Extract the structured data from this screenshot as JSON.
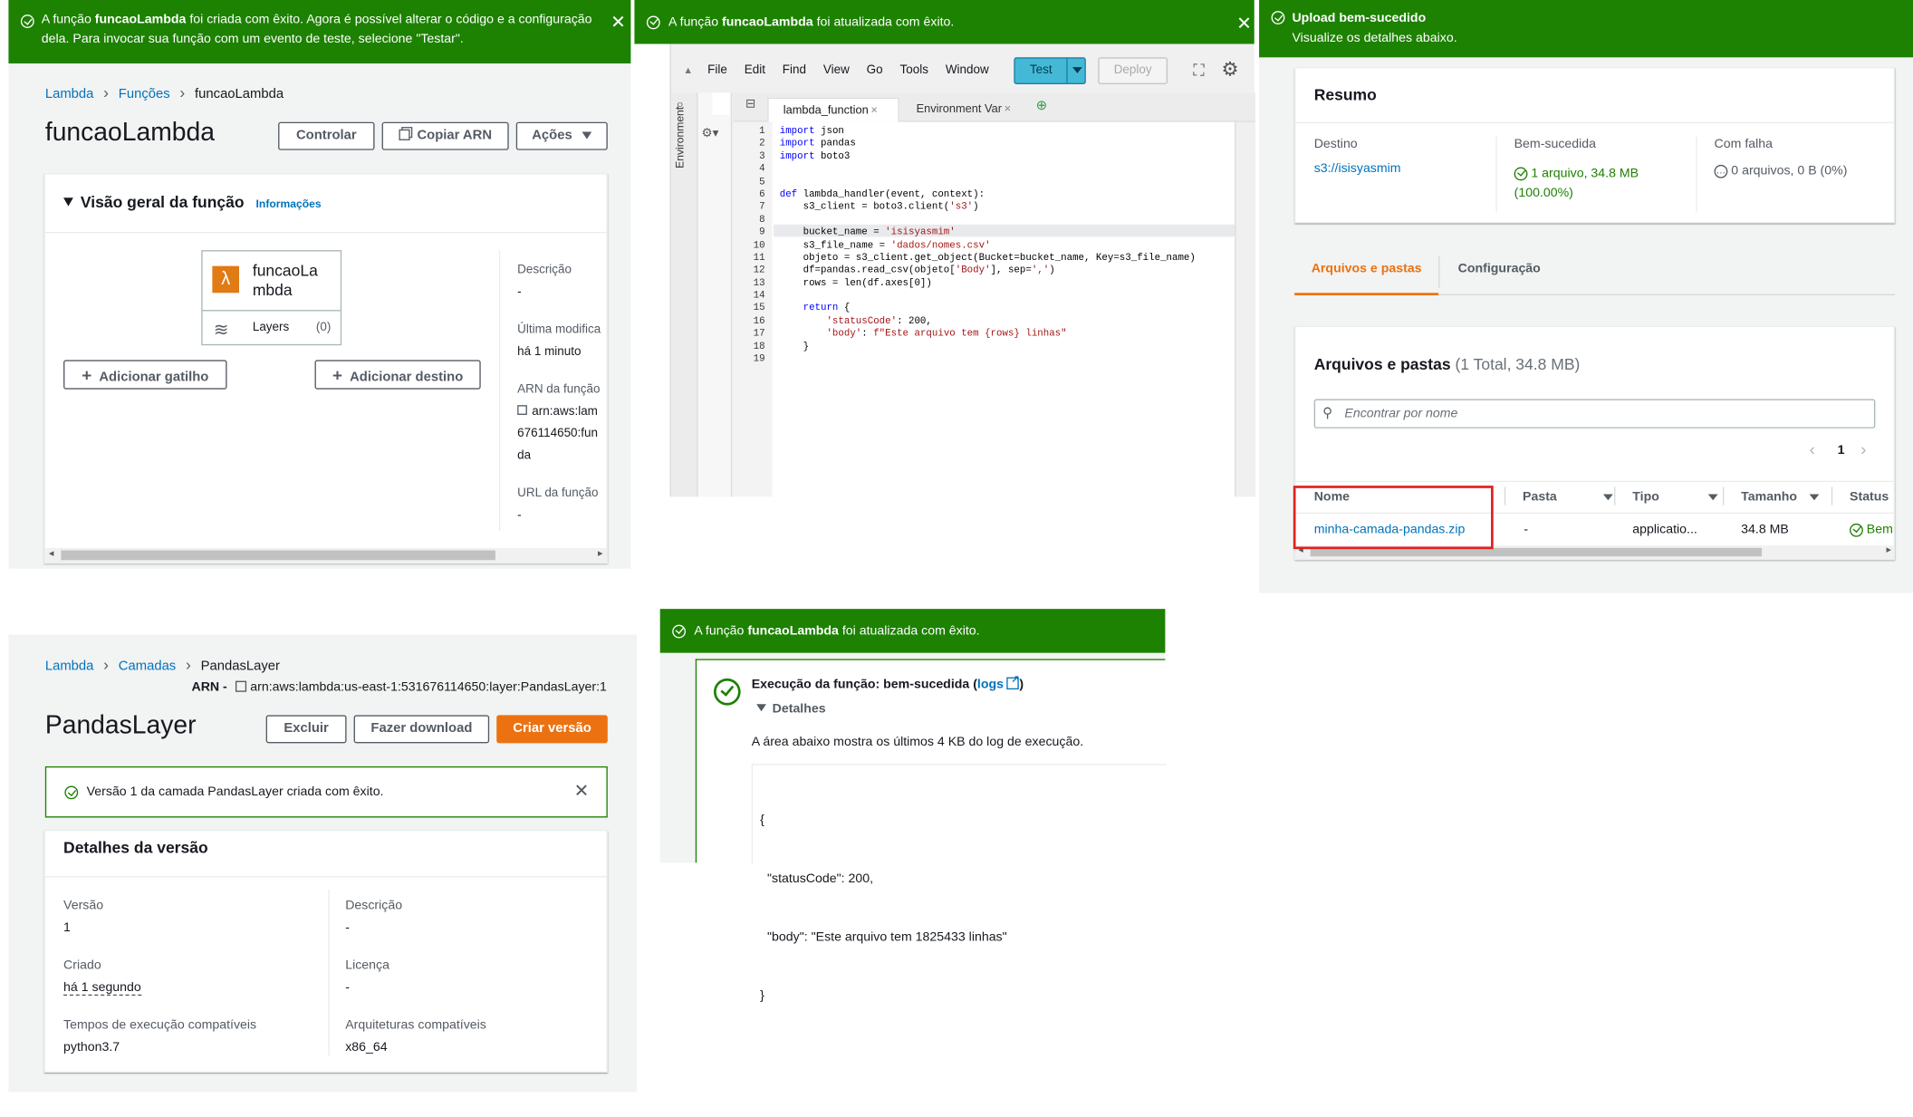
{
  "p1": {
    "flash_pre": "A função ",
    "flash_bold": "funcaoLambda",
    "flash_post": " foi criada com êxito. Agora é possível alterar o código e a configuração dela. Para invocar sua função com um evento de teste, selecione \"Testar\".",
    "breadcrumb": [
      "Lambda",
      "Funções",
      "funcaoLambda"
    ],
    "title": "funcaoLambda",
    "btn_control": "Controlar",
    "btn_copy_arn": "Copiar ARN",
    "btn_actions": "Ações",
    "overview_title": "Visão geral da função",
    "overview_info": "Informações",
    "fn_name_l1": "funcaoLa",
    "fn_name_l2": "mbda",
    "layers_label": "Layers",
    "layers_count": "(0)",
    "add_trigger": "Adicionar gatilho",
    "add_destination": "Adicionar destino",
    "desc_label": "Descrição",
    "desc_value": "-",
    "last_mod_label": "Última modifica",
    "last_mod_value": "há 1 minuto",
    "arn_label": "ARN da função",
    "arn_l1": "arn:aws:lam",
    "arn_l2": "676114650:fun",
    "arn_l3": "da",
    "url_label": "URL da função",
    "url_value": "-"
  },
  "p2": {
    "flash_pre": "A função ",
    "flash_bold": "funcaoLambda",
    "flash_post": " foi atualizada com êxito.",
    "menu": [
      "File",
      "Edit",
      "Find",
      "View",
      "Go",
      "Tools",
      "Window"
    ],
    "btn_test": "Test",
    "btn_deploy": "Deploy",
    "tab_active": "lambda_function",
    "tab_env": "Environment Var",
    "env_side": "Environment",
    "code_lines": [
      "import json",
      "import pandas",
      "import boto3",
      "",
      "",
      "def lambda_handler(event, context):",
      "    s3_client = boto3.client('s3')",
      "",
      "    bucket_name = 'isisyasmim'",
      "    s3_file_name = 'dados/nomes.csv'",
      "    objeto = s3_client.get_object(Bucket=bucket_name, Key=s3_file_name)",
      "    df=pandas.read_csv(objeto['Body'], sep=',')",
      "    rows = len(df.axes[0])",
      "",
      "    return {",
      "        'statusCode': 200,",
      "        'body': f\"Este arquivo tem {rows} linhas\"",
      "    }",
      ""
    ]
  },
  "p3": {
    "flash_title": "Upload bem-sucedido",
    "flash_sub": "Visualize os detalhes abaixo.",
    "summary_title": "Resumo",
    "dest_label": "Destino",
    "dest_value": "s3://isisyasmim",
    "success_label": "Bem-sucedida",
    "success_value": "1 arquivo, 34.8 MB",
    "success_pct": "(100.00%)",
    "fail_label": "Com falha",
    "fail_value": "0 arquivos, 0 B (0%)",
    "tab_files": "Arquivos e pastas",
    "tab_config": "Configuração",
    "files_title": "Arquivos e pastas",
    "files_count": "(1 Total, 34.8 MB)",
    "search_placeholder": "Encontrar por nome",
    "page_num": "1",
    "cols": [
      "Nome",
      "Pasta",
      "Tipo",
      "Tamanho",
      "Status"
    ],
    "row": {
      "name": "minha-camada-pandas.zip",
      "folder": "-",
      "type": "applicatio...",
      "size": "34.8 MB",
      "status": "Bem"
    },
    "highlight_color": "#e02020"
  },
  "p4": {
    "breadcrumb": [
      "Lambda",
      "Camadas",
      "PandasLayer"
    ],
    "arn_label": "ARN -",
    "arn_value": "arn:aws:lambda:us-east-1:531676114650:layer:PandasLayer:1",
    "title": "PandasLayer",
    "btn_delete": "Excluir",
    "btn_download": "Fazer download",
    "btn_create_version": "Criar versão",
    "alert": "Versão 1 da camada PandasLayer criada com êxito.",
    "details_title": "Detalhes da versão",
    "version_label": "Versão",
    "version_value": "1",
    "desc_label": "Descrição",
    "desc_value": "-",
    "created_label": "Criado",
    "created_value": "há 1 segundo",
    "license_label": "Licença",
    "license_value": "-",
    "runtimes_label": "Tempos de execução compatíveis",
    "runtimes_value": "python3.7",
    "arch_label": "Arquiteturas compatíveis",
    "arch_value": "x86_64"
  },
  "p5": {
    "flash_pre": "A função ",
    "flash_bold": "funcaoLambda",
    "flash_post": " foi atualizada com êxito.",
    "exec_title": "Execução da função: bem-sucedida (",
    "exec_logs": "logs",
    "exec_close": ")",
    "details": "Detalhes",
    "log_desc": "A área abaixo mostra os últimos 4 KB do log de execução.",
    "log_lines": [
      "{",
      "  \"statusCode\": 200,",
      "  \"body\": \"Este arquivo tem 1825433 linhas\"",
      "}"
    ]
  },
  "colors": {
    "success": "#1d8102",
    "link": "#0073bb",
    "primary": "#ec7211",
    "test_btn": "#44b9d6"
  }
}
